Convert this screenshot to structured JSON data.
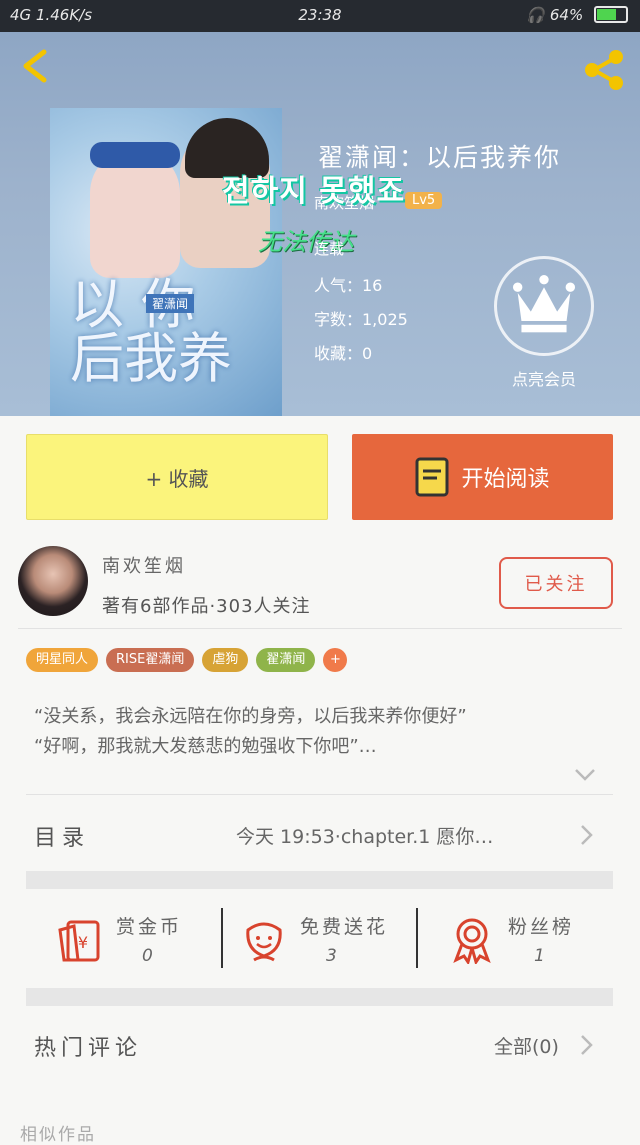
{
  "status_bar": {
    "left": "4G  1.46K/s",
    "time": "23:38",
    "battery": "64%",
    "battery_level": 0.64
  },
  "header": {
    "book_title": "翟潇闻：以后我养你",
    "overlay_korean": "전하지 못했죠",
    "overlay_green": "无法传达",
    "author": "南欢笙烟",
    "level": "Lv5",
    "status": "连载",
    "popularity": "人气：16",
    "word_count": "字数：1,025",
    "favorites": "收藏：0",
    "vip_label": "点亮会员",
    "cover": {
      "title_line1": "以   你",
      "title_line2": "后我养",
      "tag": "翟潇闻"
    }
  },
  "actions": {
    "favorite_label": "+ 收藏",
    "read_label": "开始阅读"
  },
  "author_row": {
    "name": "南欢笙烟",
    "info": "著有6部作品·303人关注",
    "follow_label": "已关注"
  },
  "tags": [
    {
      "label": "明星同人",
      "color": "#f0a53a"
    },
    {
      "label": "RISE翟潇闻",
      "color": "#c96e52"
    },
    {
      "label": "虐狗",
      "color": "#d7a335"
    },
    {
      "label": "翟潇闻",
      "color": "#8fb44a"
    },
    {
      "label": "+",
      "color": "#f07a4a"
    }
  ],
  "description": {
    "line1": "“没关系，我会永远陪在你的身旁，以后我来养你便好”",
    "line2": "“好啊，那我就大发慈悲的勉强收下你吧”…"
  },
  "toc": {
    "label": "目录",
    "latest": "今天 19:53·chapter.1 愿你…"
  },
  "stats": [
    {
      "label": "赏金币",
      "value": "0",
      "icon": "red-envelope-icon"
    },
    {
      "label": "免费送花",
      "value": "3",
      "icon": "flower-icon"
    },
    {
      "label": "粉丝榜",
      "value": "1",
      "icon": "medal-icon"
    }
  ],
  "comments": {
    "title": "热门评论",
    "all_label": "全部(0)"
  },
  "similar": {
    "title": "相似作品"
  }
}
